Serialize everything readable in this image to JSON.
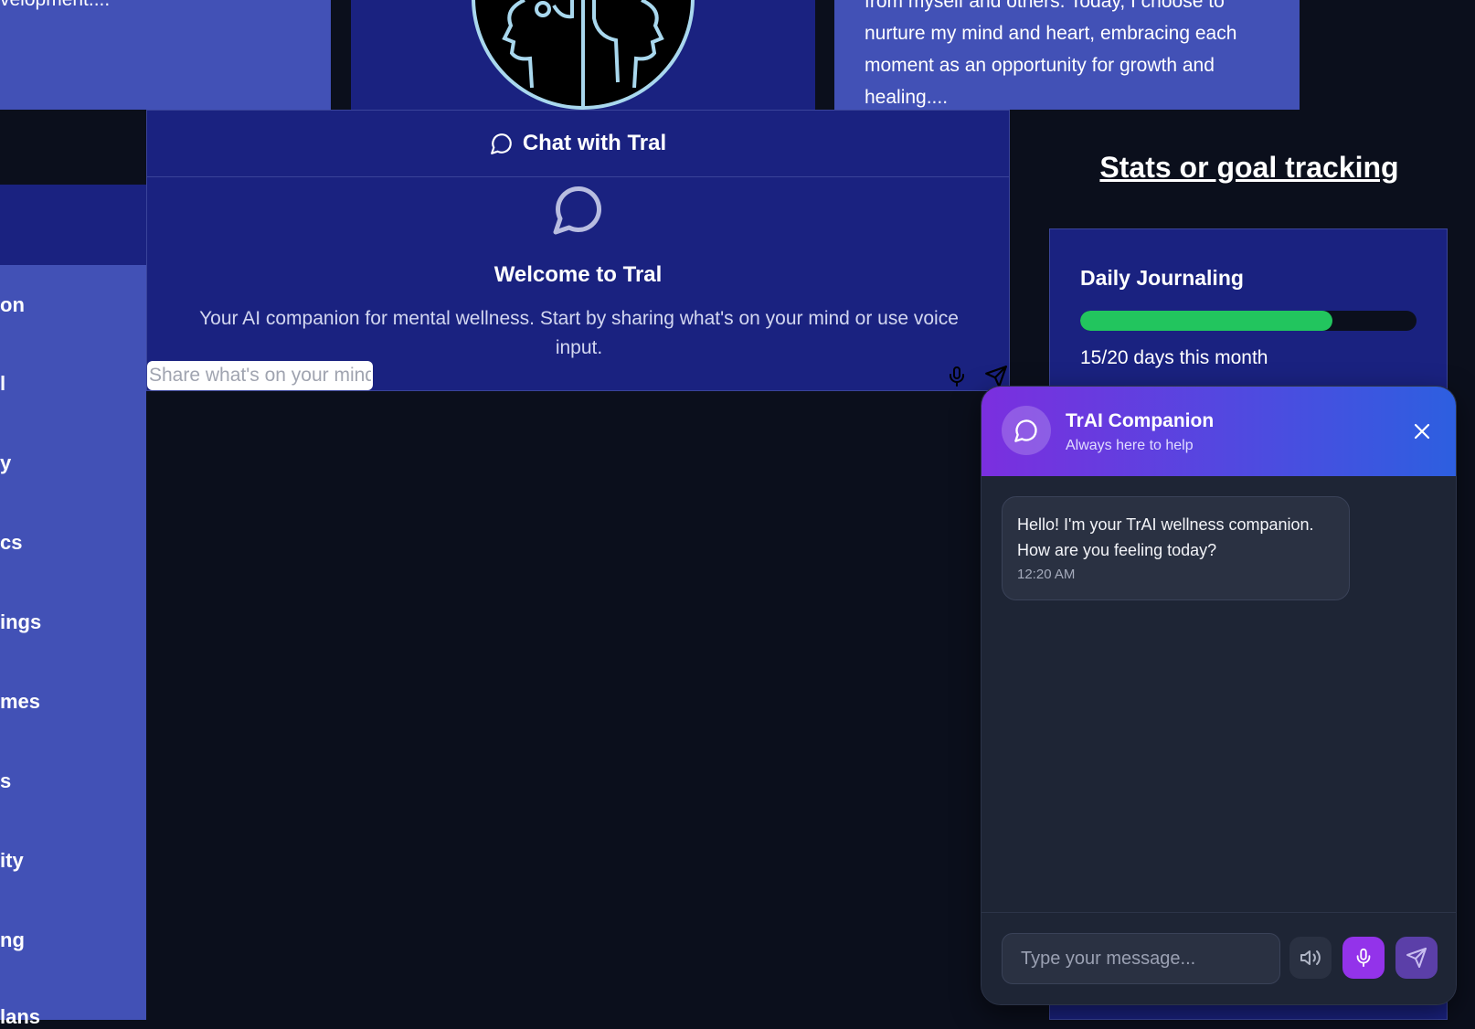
{
  "top_cards": {
    "left_text": "velopment....",
    "right_text_lines": [
      "from myself and others. Today, I choose to",
      "nurture my mind and heart, embracing each",
      "moment as an opportunity for growth and",
      "healing...."
    ]
  },
  "sidebar": {
    "items": [
      {
        "label": "on"
      },
      {
        "label": "l"
      },
      {
        "label": "y"
      },
      {
        "label": "cs"
      },
      {
        "label": "ings"
      },
      {
        "label": "mes"
      },
      {
        "label": "s"
      },
      {
        "label": "ity"
      },
      {
        "label": "ng"
      },
      {
        "label": "lans"
      }
    ]
  },
  "chat": {
    "header_title": "Chat with Tral",
    "welcome_title": "Welcome to Tral",
    "welcome_subtitle": "Your AI companion for mental wellness. Start by sharing what's on your mind or use voice input.",
    "input_placeholder": "Share what's on your mind",
    "icons": {
      "header": "chat-bubble-icon",
      "mic": "microphone-icon",
      "send": "send-icon"
    }
  },
  "stats": {
    "heading": "Stats or goal tracking",
    "goal": {
      "title": "Daily Journaling",
      "progress_percent": 75,
      "progress_text": "15/20 days this month"
    },
    "progress_color": "#22c55e"
  },
  "companion": {
    "title": "TrAI Companion",
    "subtitle": "Always here to help",
    "message": "Hello! I'm your TrAI wellness companion. How are you feeling today?",
    "message_time": "12:20 AM",
    "input_placeholder": "Type your message...",
    "icons": {
      "avatar": "chat-bubble-icon",
      "close": "close-icon",
      "speaker": "speaker-icon",
      "mic": "microphone-icon",
      "send": "send-icon"
    },
    "colors": {
      "header_start": "#7b2fdf",
      "header_end": "#2d5fe0",
      "mic_button": "#9333ea"
    }
  }
}
